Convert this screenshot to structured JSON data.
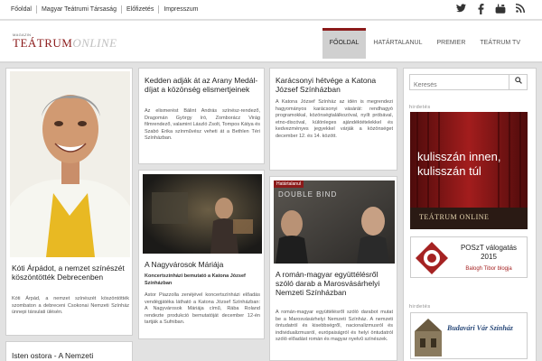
{
  "topbar": {
    "links": [
      "Főoldal",
      "Magyar Teátrumi Társaság",
      "Előfizetés",
      "Impresszum"
    ],
    "social_icons": [
      "twitter-icon",
      "facebook-icon",
      "youtube-icon",
      "rss-icon"
    ]
  },
  "logo": {
    "small": "MAGAZIN",
    "main": "TEÁTRUM",
    "online": "ONLINE"
  },
  "mainnav": [
    "FŐOLDAL",
    "HATÁRTALANUL",
    "PREMIER",
    "TEÁTRUM TV"
  ],
  "search": {
    "placeholder": "Keresés"
  },
  "sidebar": {
    "ad_label_1": "hirdetés",
    "banner_text": "kulisszán innen, kulisszán túl",
    "banner_logo": "TEÁTRUM ONLINE",
    "posz_title": "POSzT válogatás 2015",
    "posz_sub": "Balogh Tibor blogja",
    "ad_label_2": "hirdetés",
    "ad2_text": "Budavári Vár Színház"
  },
  "articles": {
    "koti": {
      "title": "Kóti Árpádot, a nemzet színészét köszöntötték Debrecenben",
      "body": "Kóti Árpád, a nemzet színészét köszöntötték szombaton a debreceni Csokonai Nemzeti Színház ünnepi társulati ülésén."
    },
    "arany": {
      "title": "Kedden adják át az Arany Medál-díjat a közönség elismertjeinek",
      "body": "Az elismerést Bálint András színész-rendező, Dragomán György író, Zomborácz Virág filmrendező, valamint László Zsolt, Tompos Kátya és Szabó Erika színművész veheti át a Bethlen Téri Színházban."
    },
    "karacsony": {
      "title": "Karácsonyi hétvége a Katona József Színházban",
      "body": "A Katona József Színház az idén is megrendezi hagyományos karácsonyi vásárát: rendhagyó programokkal, közönségtalálkozóval, nyílt próbával, etno-discóval, különleges ajándéktételekkel és kedvezményes jegyekkel várják a közönséget december 12. és 14. között."
    },
    "maria": {
      "title": "A Nagyvárosok Máriája",
      "sub": "Koncertszínházi bemutató a Katona József Színházban",
      "body": "Astor Piazzolla zenéjével koncertszínházi előadás vendégjátéka látható a Katona József Színházban: A Nagyvárosok Máriája című, Rába Roland rendezte produkció bemutatóját december 12-én tartják a Sufniban."
    },
    "roman": {
      "tag": "Határtalanul",
      "image_title": "DOUBLE BIND",
      "title": "A román-magyar együttélésről szóló darab a Marosvásárhelyi Nemzeti Színházban",
      "body": "A román-magyar együttélésről szóló darabot mutat be a Marosvásárhelyi Nemzeti Színház. A nemzeti öntudatról és kisebbségről, nacionalizmusról és individualizmusról, európaiságról és helyi öntudatról szóló előadást román és magyar nyelvű színészek."
    },
    "isten": {
      "title": "Isten ostora - A Nemzeti"
    }
  },
  "colors": {
    "accent": "#8b1a1a",
    "background": "#e2e2e2"
  }
}
